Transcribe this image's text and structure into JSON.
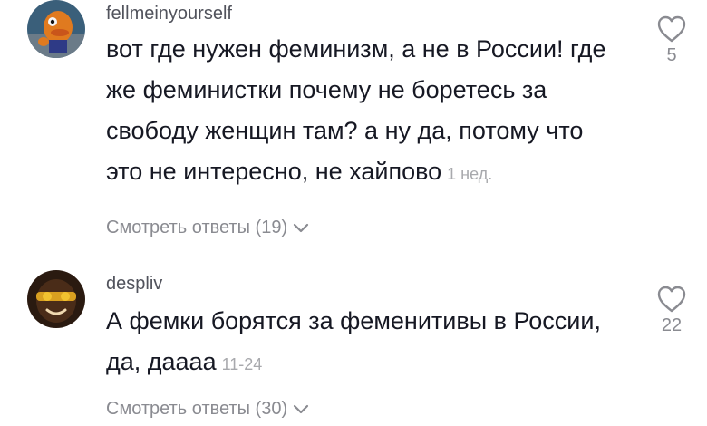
{
  "comments": [
    {
      "username": "fellmeinyourself",
      "text": "вот где нужен феминизм, а не в России! где же феминистки почему не боретесь за свободу женщин там? а ну да, потому что это не интересно, не хайпово",
      "line1": "вот где нужен феминизм, а не в России! где",
      "line2": "же феминистки почему не боретесь за",
      "line3": "свободу женщин там? а ну да, потому что",
      "line4": "это не интересно, не хайпово",
      "timestamp": "1 нед.",
      "replies_label": "Смотреть ответы (19)",
      "like_count": "5",
      "avatar_icon": "orange-character-avatar"
    },
    {
      "username": "despliv",
      "line1": "А фемки борятся за феменитивы в России,",
      "line2": "да, даааа",
      "timestamp": "11-24",
      "replies_label": "Смотреть ответы (30)",
      "like_count": "22",
      "avatar_icon": "person-avatar"
    }
  ],
  "colors": {
    "text": "#161823",
    "muted": "#8a8b91",
    "username": "#51535c",
    "timestamp": "#a8a9ad"
  }
}
